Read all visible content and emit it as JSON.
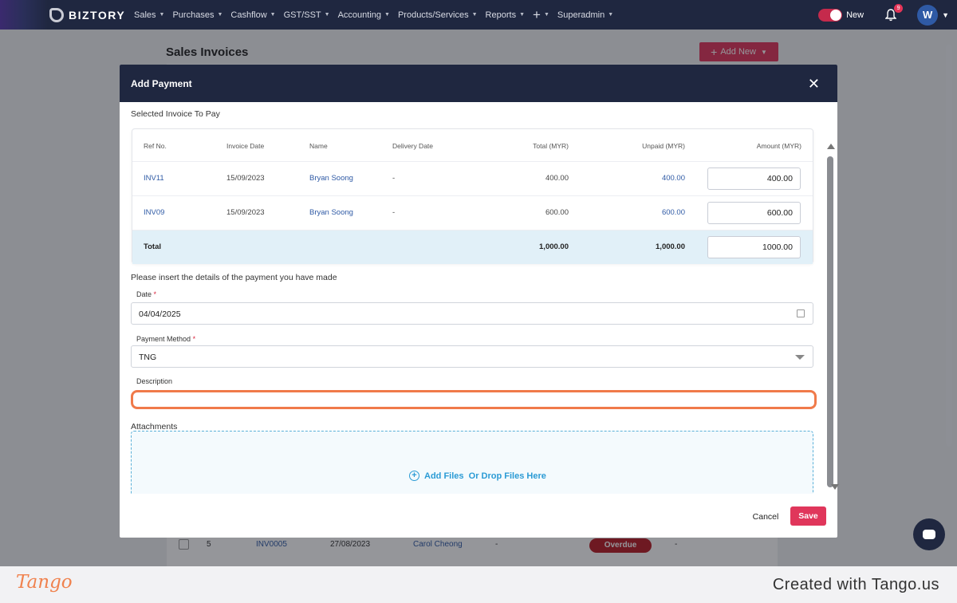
{
  "app": {
    "name": "BIZTORY"
  },
  "nav": {
    "items": [
      {
        "label": "Sales"
      },
      {
        "label": "Purchases"
      },
      {
        "label": "Cashflow"
      },
      {
        "label": "GST/SST"
      },
      {
        "label": "Accounting"
      },
      {
        "label": "Products/Services"
      },
      {
        "label": "Reports"
      }
    ],
    "superadmin": "Superadmin",
    "new_toggle_label": "New",
    "notification_count": "9",
    "avatar_initial": "W"
  },
  "page": {
    "title": "Sales Invoices",
    "add_new_label": "Add New",
    "bg_row": {
      "index": "5",
      "ref": "INV0005",
      "date": "27/08/2023",
      "name": "Carol Cheong",
      "delivery": "-",
      "status": "Overdue",
      "extra": "-"
    }
  },
  "modal": {
    "title": "Add Payment",
    "selected_label": "Selected Invoice To Pay",
    "columns": {
      "ref": "Ref No.",
      "date": "Invoice Date",
      "name": "Name",
      "delivery": "Delivery Date",
      "total": "Total (MYR)",
      "unpaid": "Unpaid (MYR)",
      "amount": "Amount (MYR)"
    },
    "rows": [
      {
        "ref": "INV11",
        "date": "15/09/2023",
        "name": "Bryan Soong",
        "delivery": "-",
        "total": "400.00",
        "unpaid": "400.00",
        "amount": "400.00"
      },
      {
        "ref": "INV09",
        "date": "15/09/2023",
        "name": "Bryan Soong",
        "delivery": "-",
        "total": "600.00",
        "unpaid": "600.00",
        "amount": "600.00"
      }
    ],
    "total_row": {
      "label": "Total",
      "total": "1,000.00",
      "unpaid": "1,000.00",
      "amount": "1000.00"
    },
    "details_label": "Please insert the details of the payment you have made",
    "date_label": "Date",
    "date_value": "04/04/2025",
    "method_label": "Payment Method",
    "method_value": "TNG",
    "required_mark": "*",
    "description_label": "Description",
    "description_value": "",
    "attachments_label": "Attachments",
    "dropzone_add": "Add Files",
    "dropzone_or": "Or Drop Files Here",
    "cancel_label": "Cancel",
    "save_label": "Save"
  },
  "footer": {
    "logo": "Tango",
    "created": "Created with Tango.us"
  },
  "colors": {
    "navy": "#1f2740",
    "accent": "#e0365b",
    "highlight": "#f07a4a",
    "link": "#2f5aa5"
  }
}
